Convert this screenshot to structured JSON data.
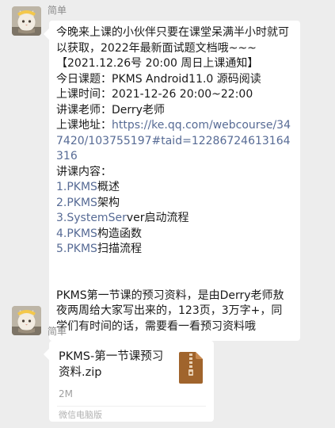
{
  "messages": [
    {
      "sender": "简单",
      "avatar_icon": "cat-avatar-icon",
      "lines": [
        "今晚来上课的小伙伴只要在课堂呆满半小时就可以获取，2022年最新面试题文档哦~~~",
        "【2021.12.26号 20:00 周日上课通知】",
        "今日课题：PKMS Android11.0 源码阅读",
        "上课时间：2021-12-26 20:00~22:00",
        "讲课老师：Derry老师",
        "上课地址：",
        "https://ke.qq.com/webcourse/347420/103755197#taid=12286724613164316",
        "讲课内容：",
        "1.PKMS",
        "概述",
        "2.PKMS",
        "架构",
        "3.SystemSer",
        "ver启动流程",
        "4.PKMS",
        "构造函数",
        "5.PKMS",
        "扫描流程",
        "PKMS第一节课的预习资料，是由Derry老师敖夜两周给大家写出来的，123页，3万字+，同学们有时间的话，需要看一看预习资料哦"
      ]
    },
    {
      "sender": "简单",
      "avatar_icon": "cat-avatar-icon",
      "file": {
        "name": "PKMS-第一节课预习资料.zip",
        "size": "2M",
        "source": "微信电脑版",
        "icon": "zip-file-icon"
      }
    }
  ],
  "colors": {
    "background": "#ededed",
    "bubble": "#ffffff",
    "link": "#576b95",
    "zip_icon": "#a0642c"
  }
}
